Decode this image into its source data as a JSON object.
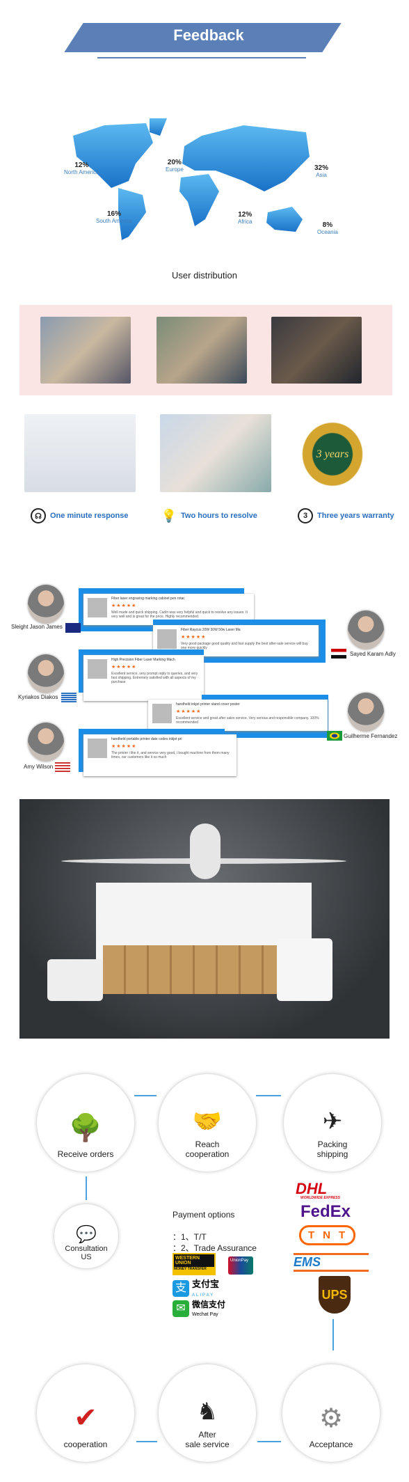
{
  "banner": {
    "title": "Feedback"
  },
  "distribution": {
    "caption": "User distribution",
    "regions": [
      {
        "name": "North America",
        "pct": "12%"
      },
      {
        "name": "Europe",
        "pct": "20%"
      },
      {
        "name": "Asia",
        "pct": "32%"
      },
      {
        "name": "South America",
        "pct": "16%"
      },
      {
        "name": "Africa",
        "pct": "12%"
      },
      {
        "name": "Oceania",
        "pct": "8%"
      }
    ]
  },
  "services": [
    {
      "label": "One minute response",
      "icon": "headset-icon"
    },
    {
      "label": "Two hours to resolve",
      "icon": "lightbulb-icon"
    },
    {
      "label": "Three years warranty",
      "icon": "shield-icon"
    }
  ],
  "warranty_badge": "3 years",
  "reviews": [
    {
      "name": "Sleight Jason James",
      "country": "Australia",
      "title": "Fiber laser engraving marking cabinet pen rotar.",
      "stars": 5,
      "text": "Well made and quick shipping. Carlin was very helpful and quick to resolve any issues. It very well and is great for the price. Highly recommended."
    },
    {
      "name": "Sayed Karam Adly",
      "country": "Egypt",
      "title": "Fiber Raycus 20W 30W 50w Laser Ma",
      "stars": 5,
      "text": "Very good package good quality and fast supply the best after-sale service will buy one more quickly"
    },
    {
      "name": "Kyriakos Diakos",
      "country": "Greece",
      "title": "High Precision Fiber Laser Marking Mach",
      "stars": 5,
      "text": "Excellent service, very prompt reply to queries, and very fast shipping. Extremely satisfied with all aspects of my purchase"
    },
    {
      "name": "Guilherme Fernandez",
      "country": "Brazil",
      "title": "handheld inkjet printer stand cover poster",
      "stars": 5,
      "text": "Excellent service and great after sales service. Very serious and responsible company. 100% recommended"
    },
    {
      "name": "Amy Wilson",
      "country": "USA",
      "title": "handheld portable printer date codes inkjet pri",
      "stars": 5,
      "text": "The printer i like it, and service very good, i bought machine from them many times, our customers like it so much"
    }
  ],
  "process": {
    "receive": "Receive orders",
    "reach": [
      "Reach",
      "cooperation"
    ],
    "packing": [
      "Packing",
      "shipping"
    ],
    "consult": [
      "Consultation",
      "US"
    ],
    "acceptance": "Acceptance",
    "after_sale": [
      "After",
      "sale service"
    ],
    "cooperation": "cooperation"
  },
  "payment": {
    "title": "Payment options",
    "items": [
      "：1、T/T",
      "：2、Trade Assurance"
    ],
    "logos": [
      "WESTERN UNION",
      "MONEY TRANSFER",
      "UnionPay",
      "支付宝",
      "ALIPAY",
      "微信支付",
      "Wechat Pay"
    ]
  },
  "couriers": [
    "DHL",
    "WORLDWIDE EXPRESS",
    "FedEx",
    "TNT",
    "EMS",
    "UPS"
  ]
}
